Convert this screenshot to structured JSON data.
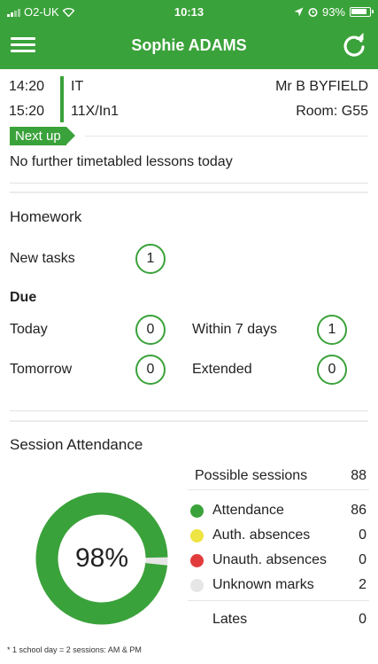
{
  "status_bar": {
    "carrier": "O2-UK",
    "time": "10:13",
    "battery": "93%"
  },
  "header": {
    "title": "Sophie ADAMS"
  },
  "current_lesson": {
    "start": "14:20",
    "end": "15:20",
    "subject": "IT",
    "class": "11X/In1",
    "teacher": "Mr B BYFIELD",
    "room": "Room: G55"
  },
  "next_up": {
    "label": "Next up",
    "message": "No further timetabled lessons today"
  },
  "homework": {
    "title": "Homework",
    "new_tasks_label": "New tasks",
    "new_tasks_count": "1",
    "due_label": "Due",
    "today_label": "Today",
    "today_count": "0",
    "within7_label": "Within 7 days",
    "within7_count": "1",
    "tomorrow_label": "Tomorrow",
    "tomorrow_count": "0",
    "extended_label": "Extended",
    "extended_count": "0"
  },
  "attendance": {
    "title": "Session Attendance",
    "percent": 98,
    "percent_label": "98%",
    "possible_label": "Possible sessions",
    "possible_value": "88",
    "rows": [
      {
        "label": "Attendance",
        "value": "86",
        "color": "#3aa23a"
      },
      {
        "label": "Auth. absences",
        "value": "0",
        "color": "#eee443"
      },
      {
        "label": "Unauth. absences",
        "value": "0",
        "color": "#e23b3b"
      },
      {
        "label": "Unknown marks",
        "value": "2",
        "color": "#e6e6e6"
      }
    ],
    "lates_label": "Lates",
    "lates_value": "0",
    "footnote": "* 1 school day = 2 sessions: AM & PM"
  },
  "colors": {
    "brand_green": "#3aa23a",
    "donut_track": "#e6e6e6"
  }
}
